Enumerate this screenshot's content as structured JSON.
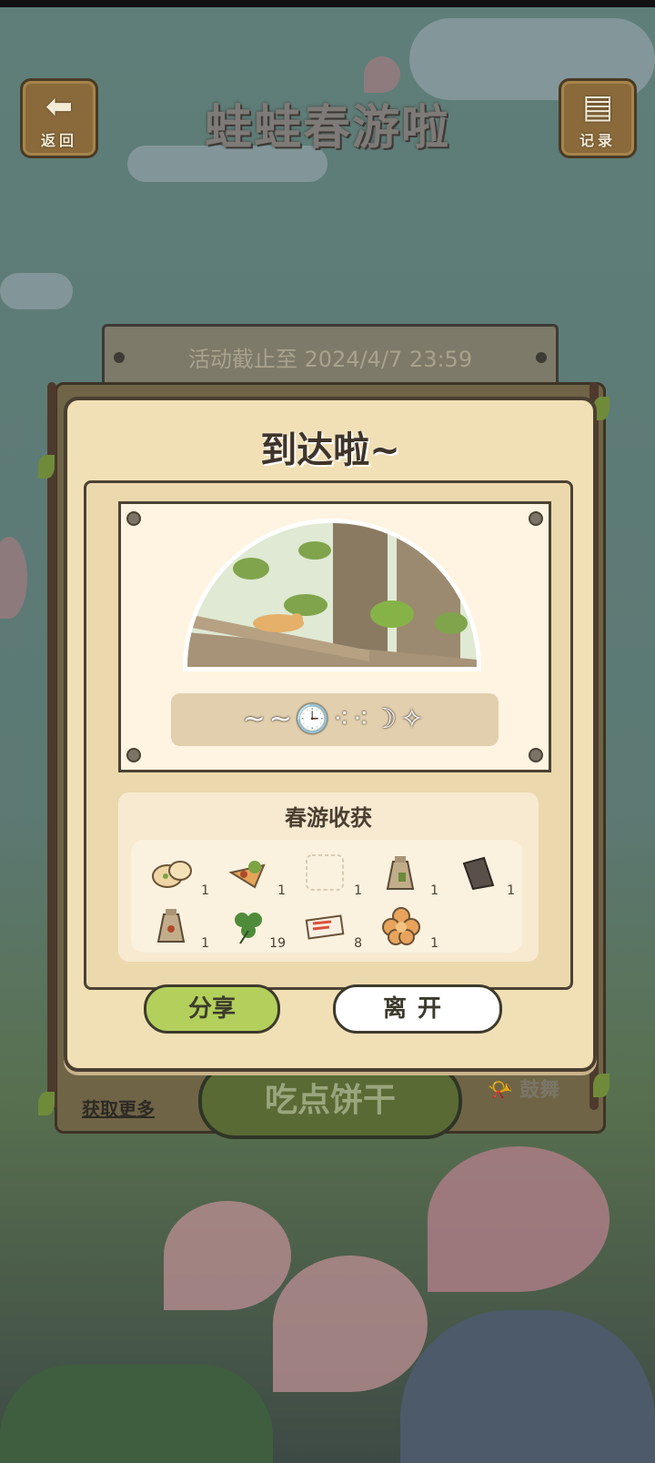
{
  "header": {
    "back_label": "返回",
    "title": "蛙蛙春游啦",
    "record_label": "记录"
  },
  "event": {
    "deadline": "活动截止至 2024/4/7 23:59"
  },
  "background": {
    "main_button_label": "吃点饼干",
    "more_link": "获取更多",
    "encourage_label": "鼓舞"
  },
  "modal": {
    "title": "到达啦~",
    "status_strip": "~~🕒⁖⁖☽✧",
    "harvest_title": "春游收获",
    "items": [
      {
        "icon": "bread-icon",
        "count": "1"
      },
      {
        "icon": "veggie-pie-icon",
        "count": "1"
      },
      {
        "icon": "empty-slot",
        "count": "1"
      },
      {
        "icon": "bag-icon",
        "count": "1"
      },
      {
        "icon": "wood-icon",
        "count": "1"
      },
      {
        "icon": "sack-icon",
        "count": "1"
      },
      {
        "icon": "clover-icon",
        "count": "19"
      },
      {
        "icon": "ticket-icon",
        "count": "8"
      },
      {
        "icon": "flower-cookie-icon",
        "count": "1"
      }
    ],
    "share_label": "分享",
    "leave_label": "离开"
  },
  "colors": {
    "modal_bg": "#f1dfb5",
    "share_button": "#b3cf5c",
    "outline": "#4a3f31"
  }
}
